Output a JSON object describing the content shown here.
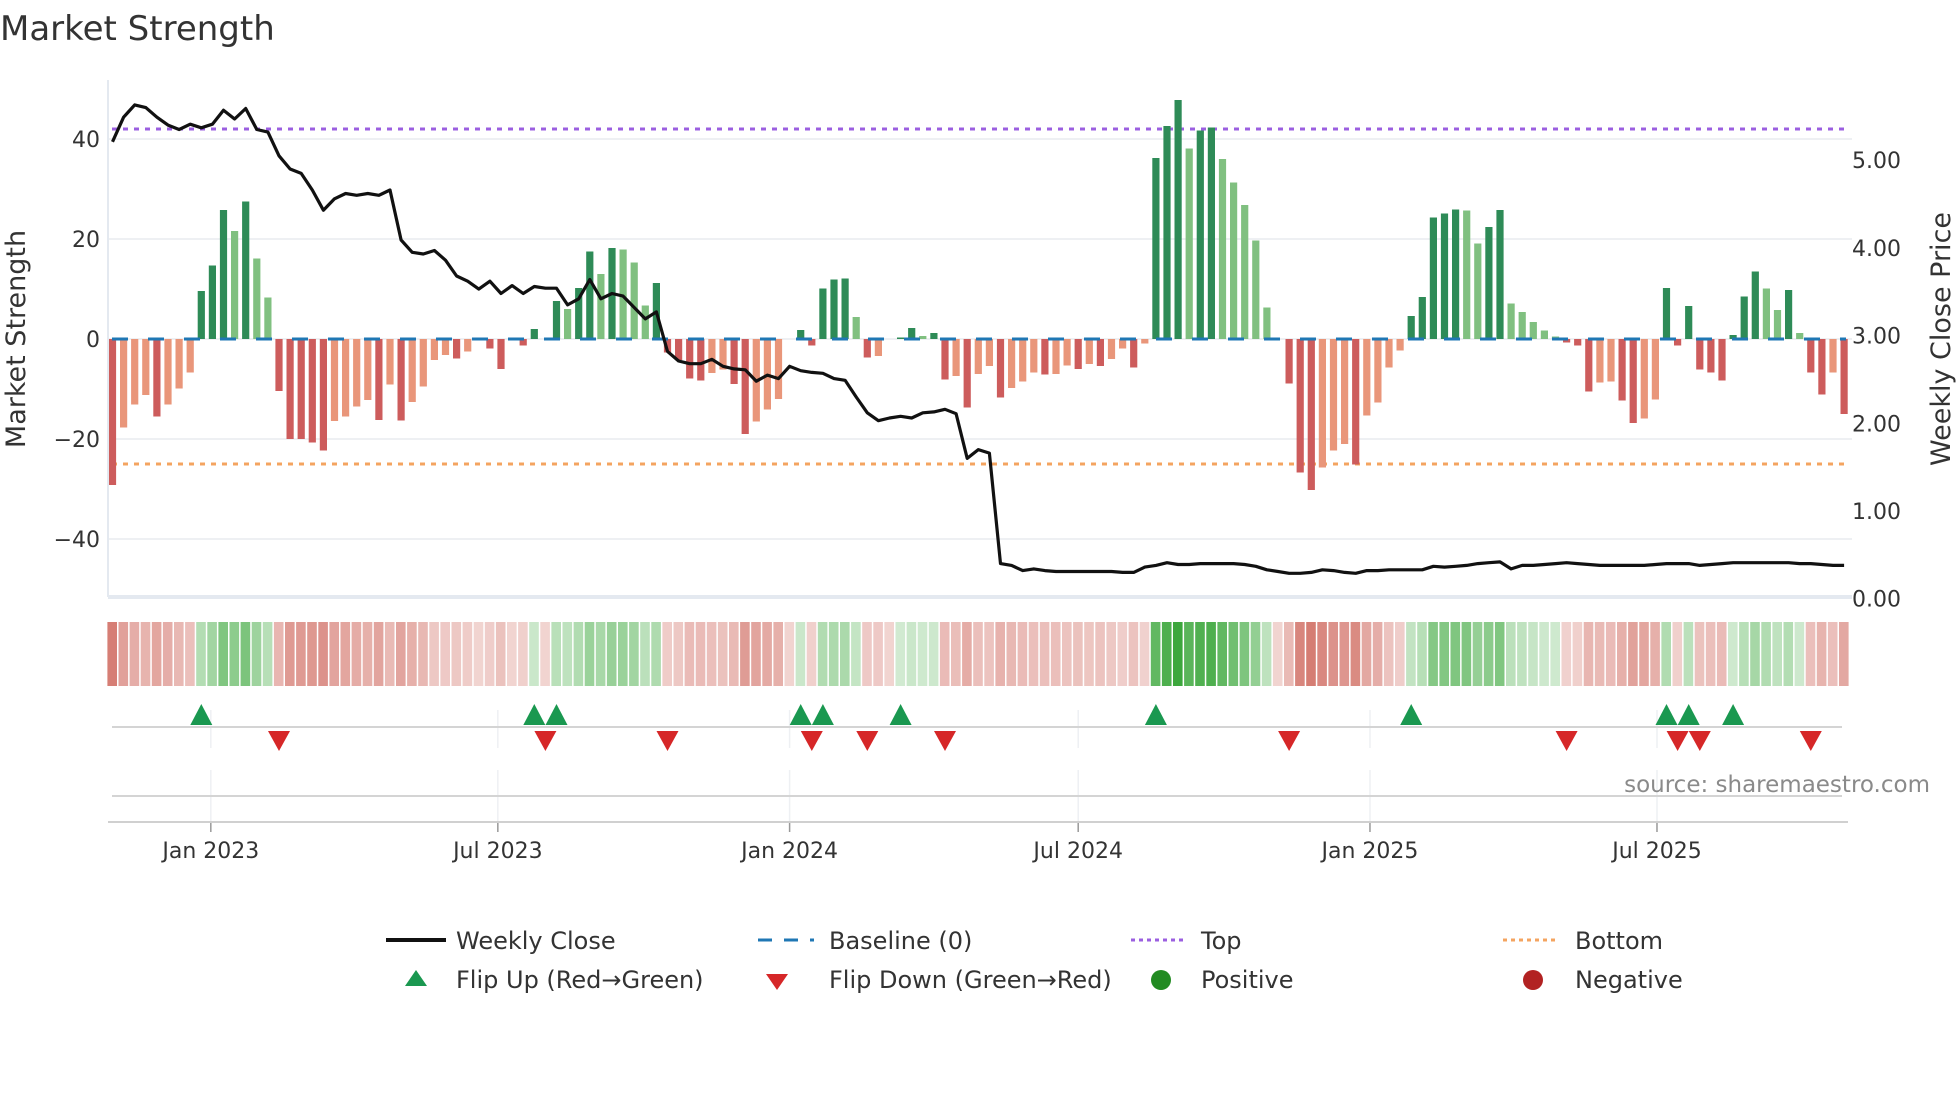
{
  "chart_data": {
    "type": "bar",
    "title": "Market Strength",
    "ylabel": "Market Strength",
    "ylabel_right": "Weekly Close Price",
    "ylim": [
      -52,
      52
    ],
    "ylim_right": [
      0,
      5.9
    ],
    "start_date": "2022-10-31",
    "frequency": "weekly",
    "yticks": [
      {
        "v": 40,
        "label": "40"
      },
      {
        "v": 20,
        "label": "20"
      },
      {
        "v": 0,
        "label": "0"
      },
      {
        "v": -20,
        "label": "−20"
      },
      {
        "v": -40,
        "label": "−40"
      }
    ],
    "yticks_right": [
      {
        "v": 5,
        "label": "5.00"
      },
      {
        "v": 4,
        "label": "4.00"
      },
      {
        "v": 3,
        "label": "3.00"
      },
      {
        "v": 2,
        "label": "2.00"
      },
      {
        "v": 1,
        "label": "1.00"
      },
      {
        "v": 0,
        "label": "0.00"
      }
    ],
    "xticks": [
      {
        "date": "2023-01-01",
        "label": "Jan 2023"
      },
      {
        "date": "2023-07-01",
        "label": "Jul 2023"
      },
      {
        "date": "2024-01-01",
        "label": "Jan 2024"
      },
      {
        "date": "2024-07-01",
        "label": "Jul 2024"
      },
      {
        "date": "2025-01-01",
        "label": "Jan 2025"
      },
      {
        "date": "2025-07-01",
        "label": "Jul 2025"
      }
    ],
    "top_level": 42,
    "bottom_level": -25,
    "baseline": 0,
    "strength": [
      -29.2,
      -17.7,
      -13.1,
      -11.2,
      -15.5,
      -13.1,
      -9.9,
      -6.7,
      9.6,
      14.7,
      25.8,
      21.6,
      27.5,
      16.1,
      8.3,
      -10.4,
      -20,
      -20,
      -20.7,
      -22.3,
      -16.4,
      -15.5,
      -13.5,
      -12.2,
      -16.2,
      -9.1,
      -16.3,
      -12.6,
      -9.5,
      -4.2,
      -3.2,
      -3.9,
      -2.5,
      0,
      -1.9,
      -6.0,
      0,
      -1.3,
      2,
      0,
      7.6,
      6,
      10.2,
      17.5,
      13,
      18.2,
      17.9,
      15.3,
      6.7,
      11.2,
      -2.7,
      -4.2,
      -7.9,
      -8.3,
      -6.8,
      -6.1,
      -9,
      -19,
      -16.5,
      -14.1,
      -12,
      0,
      1.8,
      -1.3,
      10.1,
      11.9,
      12.1,
      4.4,
      -3.7,
      -3.4,
      0,
      0.3,
      2.2,
      0.6,
      1.2,
      -8.1,
      -7.4,
      -13.7,
      -7,
      -5.4,
      -11.7,
      -9.8,
      -8.5,
      -6.7,
      -7.1,
      -7,
      -5.3,
      -6,
      -5,
      -5.4,
      -4,
      -1.9,
      -5.7,
      -0.9,
      36.2,
      42.6,
      47.8,
      38.1,
      41.7,
      42.3,
      36,
      31.3,
      26.8,
      19.7,
      6.3,
      0,
      -8.9,
      -26.7,
      -30.2,
      -25.7,
      -22.3,
      -21,
      -25.1,
      -15.3,
      -12.7,
      -5.7,
      -2.3,
      4.6,
      8.4,
      24.3,
      25.1,
      25.9,
      25.7,
      19.1,
      22.4,
      25.8,
      7.1,
      5.4,
      3.4,
      1.7,
      0.5,
      -0.7,
      -1.3,
      -10.5,
      -8.7,
      -8.5,
      -12.3,
      -16.8,
      -15.9,
      -12.1,
      10.2,
      -1.3,
      6.6,
      -6.1,
      -6.7,
      -8.3,
      0.8,
      8.5,
      13.5,
      10.1,
      5.8,
      9.8,
      1.2,
      -6.7,
      -11.1,
      -6.7,
      -15
    ],
    "weekly_close": [
      5.21,
      5.49,
      5.63,
      5.6,
      5.49,
      5.4,
      5.35,
      5.41,
      5.37,
      5.41,
      5.57,
      5.47,
      5.59,
      5.35,
      5.32,
      5.05,
      4.9,
      4.85,
      4.66,
      4.43,
      4.56,
      4.62,
      4.6,
      4.62,
      4.6,
      4.66,
      4.09,
      3.95,
      3.93,
      3.97,
      3.86,
      3.68,
      3.62,
      3.53,
      3.62,
      3.48,
      3.57,
      3.48,
      3.56,
      3.54,
      3.54,
      3.35,
      3.42,
      3.64,
      3.42,
      3.48,
      3.45,
      3.32,
      3.19,
      3.27,
      2.82,
      2.71,
      2.68,
      2.68,
      2.73,
      2.65,
      2.62,
      2.61,
      2.48,
      2.55,
      2.51,
      2.65,
      2.6,
      2.58,
      2.57,
      2.51,
      2.49,
      2.3,
      2.12,
      2.03,
      2.06,
      2.08,
      2.06,
      2.12,
      2.13,
      2.16,
      2.11,
      1.6,
      1.7,
      1.66,
      0.4,
      0.38,
      0.32,
      0.34,
      0.32,
      0.31,
      0.31,
      0.31,
      0.31,
      0.31,
      0.31,
      0.3,
      0.3,
      0.36,
      0.38,
      0.41,
      0.39,
      0.39,
      0.4,
      0.4,
      0.4,
      0.4,
      0.39,
      0.37,
      0.33,
      0.31,
      0.29,
      0.29,
      0.3,
      0.33,
      0.32,
      0.3,
      0.29,
      0.32,
      0.32,
      0.33,
      0.33,
      0.33,
      0.33,
      0.37,
      0.36,
      0.37,
      0.38,
      0.4,
      0.41,
      0.42,
      0.34,
      0.38,
      0.38,
      0.39,
      0.4,
      0.41,
      0.4,
      0.39,
      0.38,
      0.38,
      0.38,
      0.38,
      0.38,
      0.39,
      0.4,
      0.4,
      0.4,
      0.38,
      0.39,
      0.4,
      0.41,
      0.41,
      0.41,
      0.41,
      0.41,
      0.41,
      0.4,
      0.4,
      0.39,
      0.38,
      0.38
    ],
    "flip_up": [
      "2022-12-26",
      "2023-07-24",
      "2023-08-07",
      "2024-01-08",
      "2024-01-22",
      "2024-03-11",
      "2024-08-19",
      "2025-01-27",
      "2025-07-07",
      "2025-07-21",
      "2025-08-18"
    ],
    "flip_down": [
      "2023-02-13",
      "2023-07-31",
      "2023-10-16",
      "2024-01-15",
      "2024-02-19",
      "2024-04-08",
      "2024-11-11",
      "2025-05-05",
      "2025-07-14",
      "2025-07-28",
      "2025-10-06"
    ],
    "colors": {
      "rising_positive": "#2e8b57",
      "falling_positive": "#80c080",
      "falling_negative": "#cd5c5c",
      "rising_negative": "#e9967a",
      "close": "#111111",
      "baseline": "#1f77b4",
      "top": "#9b5fe0",
      "bottom": "#f4a460",
      "flip_up": "#1a9850",
      "flip_down": "#d62728",
      "positive": "#228b22",
      "negative": "#b22222"
    },
    "legend": {
      "placement": "bottom",
      "items": [
        "Weekly Close",
        "Baseline (0)",
        "Top",
        "Bottom",
        "Flip Up (Red→Green)",
        "Flip Down (Green→Red)",
        "Positive",
        "Negative"
      ]
    },
    "source": "source: sharemaestro.com"
  }
}
